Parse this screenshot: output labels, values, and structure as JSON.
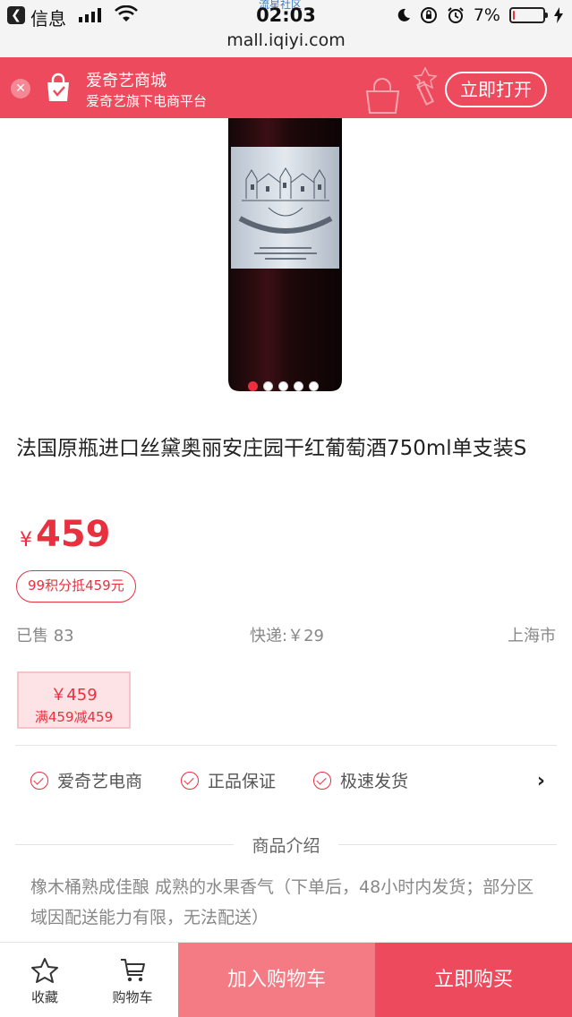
{
  "status_bar": {
    "back_app": "信息",
    "time": "02:03",
    "watermark": "流星社区",
    "url": "mall.iqiyi.com",
    "battery": "7%",
    "battery_level": 0.07
  },
  "banner": {
    "title": "爱奇艺商城",
    "subtitle": "爱奇艺旗下电商平台",
    "open_label": "立即打开"
  },
  "product": {
    "title": "法国原瓶进口丝黛奥丽安庄园干红葡萄酒750ml单支装S",
    "currency": "¥",
    "price": "459",
    "points_offer": "99积分抵459元",
    "sold": "已售 83",
    "shipping": "快递:￥29",
    "location": "上海市",
    "image_count": 5,
    "active_image": 1
  },
  "coupon": {
    "amount": "￥459",
    "condition": "满459减459"
  },
  "guarantees": [
    {
      "label": "爱奇艺电商"
    },
    {
      "label": "正品保证"
    },
    {
      "label": "极速发货"
    }
  ],
  "intro": {
    "heading": "商品介绍",
    "text": "橡木桶熟成佳酿 成熟的水果香气（下单后，48小时内发货；部分区域因配送能力有限，无法配送）"
  },
  "bottom_bar": {
    "favorite_label": "收藏",
    "cart_label": "购物车",
    "add_to_cart_label": "加入购物车",
    "buy_now_label": "立即购买"
  },
  "colors": {
    "accent": "#ee4a5d",
    "add_cart": "#f47a84"
  }
}
